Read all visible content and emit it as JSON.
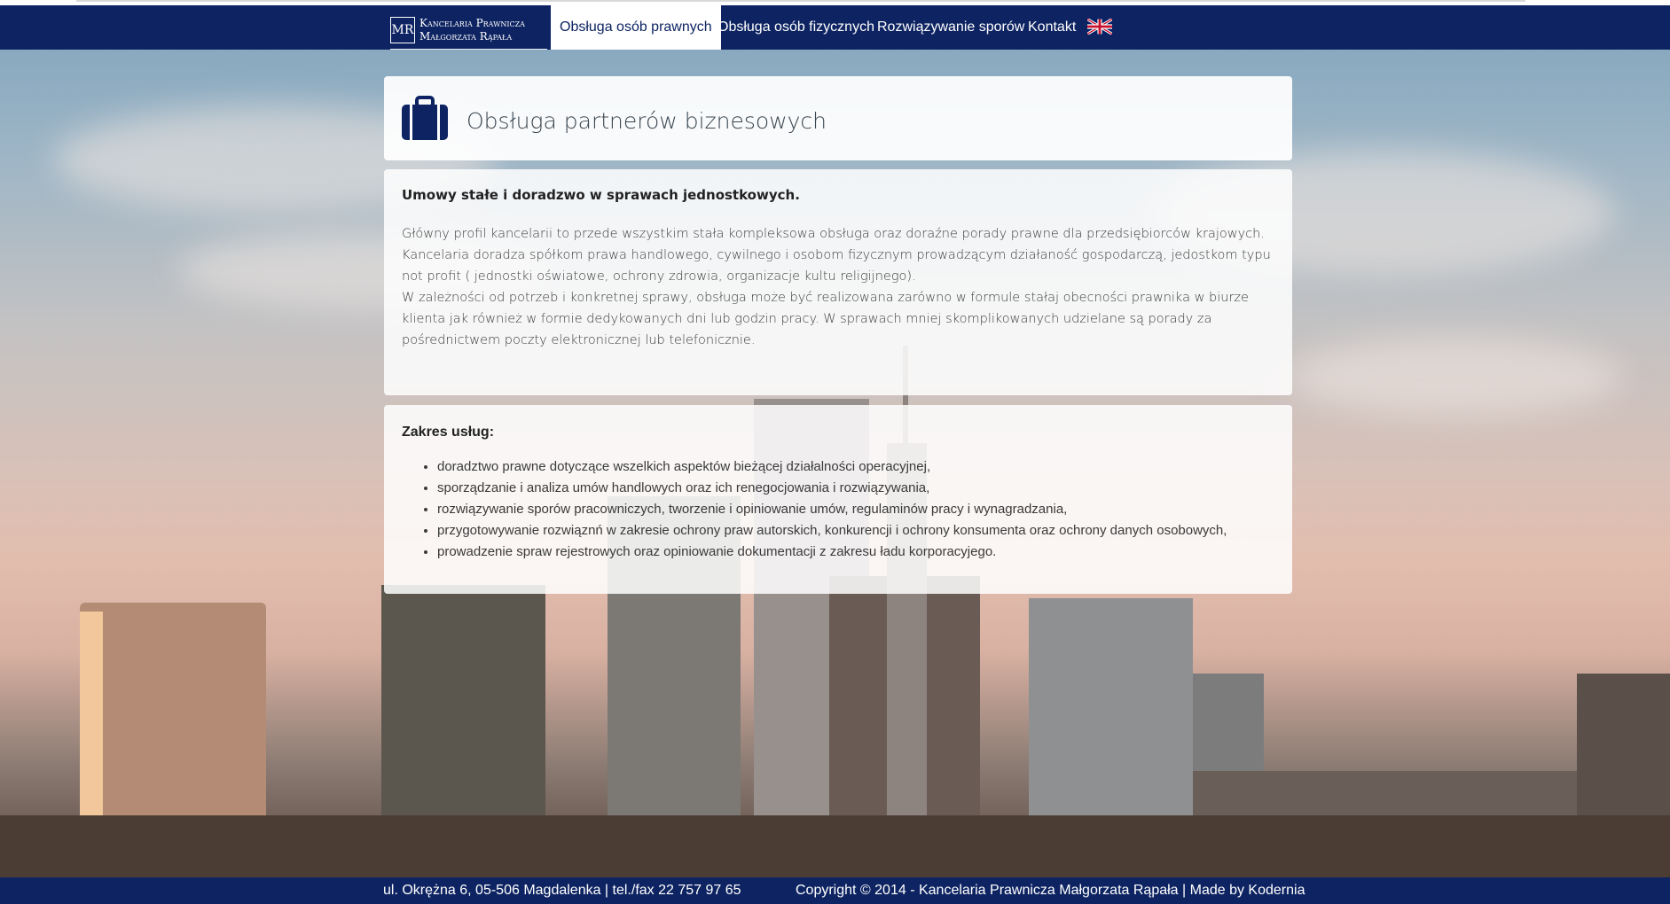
{
  "brand": {
    "logo_mark": "MR",
    "line1": "Kancelaria Prawnicza",
    "line2": "Małgorzata Rąpała"
  },
  "nav": {
    "items": [
      {
        "label": "Obsługa osób prawnych",
        "active": true
      },
      {
        "label": "Obsługa osób fizycznych",
        "active": false
      },
      {
        "label": "Rozwiązywanie sporów",
        "active": false
      },
      {
        "label": "Kontakt",
        "active": false
      }
    ],
    "language_flag": "uk-flag-icon"
  },
  "page": {
    "title_icon": "briefcase-icon",
    "title": "Obsługa partnerów biznesowych"
  },
  "intro": {
    "heading": "Umowy stałe i doradzwo w sprawach jednostkowych.",
    "paragraph1": "Główny profil kancelarii to przede wszystkim stała kompleksowa obsługa oraz doraźne porady prawne dla przedsiębiorców krajowych.",
    "paragraph2": "Kancelaria doradza spółkom prawa handlowego, cywilnego i osobom fizycznym prowadzącym działaność gospodarczą, jedostkom typu not profit ( jednostki oświatowe, ochrony zdrowia, organizacje kultu religijnego).",
    "paragraph3": "W zależności od potrzeb i konkretnej sprawy, obsługa może być realizowana zarówno w formule stałaj obecności prawnika w biurze klienta jak również w formie dedykowanych dni lub godzin pracy. W sprawach mniej skomplikowanych udzielane są porady za pośrednictwem poczty elektronicznej lub telefonicznie."
  },
  "services": {
    "heading": "Zakres usług:",
    "items": [
      "doradztwo prawne dotyczące wszelkich aspektów bieżącej działalności operacyjnej,",
      "sporządzanie i analiza umów handlowych oraz ich renegocjowania i rozwiązywania,",
      "rozwiązywanie sporów pracowniczych, tworzenie i opiniowanie umów, regulaminów pracy i wynagradzania,",
      "przygotowywanie rozwiąznń w zakresie ochrony praw autorskich, konkurencji i ochrony konsumenta oraz ochrony danych osobowych,",
      "prowadzenie spraw rejestrowych oraz opiniowanie dokumentacji z zakresu ładu korporacyjego."
    ]
  },
  "footer": {
    "address": "ul. Okrężna 6, 05-506 Magdalenka | tel./fax 22 757 97 65",
    "copyright": "Copyright © 2014 - Kancelaria Prawnicza Małgorzata Rąpała | Made by ",
    "credit_link": "Kodernia"
  },
  "colors": {
    "navy": "#0e2462",
    "panel_bg": "rgba(255,255,255,0.85)"
  }
}
